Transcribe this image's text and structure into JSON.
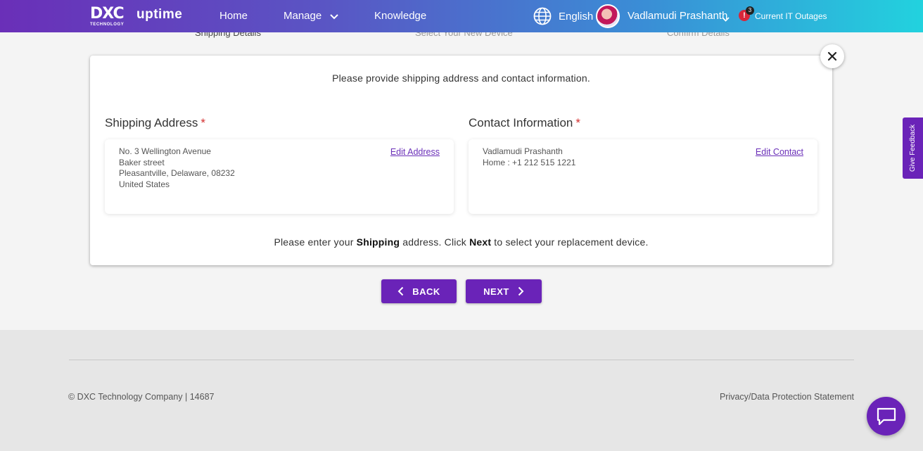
{
  "header": {
    "logo_mark": "DXC",
    "logo_sub": "TECHNOLOGY",
    "app_name": "uptime",
    "nav": {
      "home": "Home",
      "manage": "Manage",
      "knowledge": "Knowledge"
    },
    "language": "English",
    "user_name": "Vadlamudi Prashanth",
    "outage_icon": "!",
    "outage_count": "3",
    "outage_label": "Current IT Outages"
  },
  "stepper": {
    "step1": "Shipping Details",
    "step2": "Select Your New Device",
    "step3": "Confirm Details"
  },
  "card": {
    "intro": "Please provide shipping address and contact information.",
    "shipping": {
      "title": "Shipping Address",
      "required_mark": "*",
      "line1": "No. 3 Wellington Avenue",
      "line2": "Baker street",
      "line3": "Pleasantville, Delaware, 08232",
      "line4": "United States",
      "edit_label": "Edit Address"
    },
    "contact": {
      "title": "Contact Information",
      "required_mark": "*",
      "name": "Vadlamudi Prashanth",
      "phone": "Home : +1 212 515 1221",
      "edit_label": "Edit Contact"
    },
    "hint": {
      "part1": "Please enter your ",
      "bold1": "Shipping",
      "part2": " address. Click ",
      "bold2": "Next",
      "part3": " to select your replacement device."
    }
  },
  "buttons": {
    "back": "BACK",
    "next": "NEXT"
  },
  "footer": {
    "copyright": "© DXC Technology Company | 14687",
    "privacy": "Privacy/Data Protection Statement"
  },
  "feedback": "Give Feedback",
  "colors": {
    "brand_purple": "#6a23b8",
    "required_red": "#d32f2f",
    "outage_red": "#d8263a"
  }
}
